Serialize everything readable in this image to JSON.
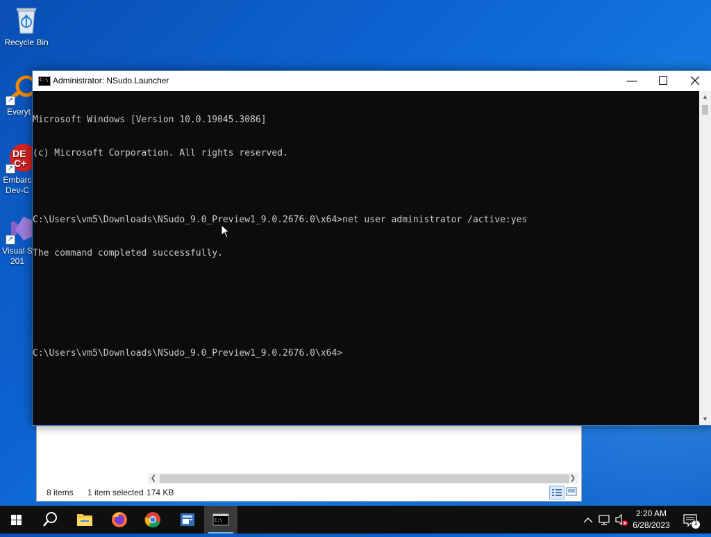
{
  "desktop": {
    "icons": [
      {
        "label": "Recycle Bin"
      },
      {
        "label": "Everyt"
      },
      {
        "label": "Embarc\nDev-C"
      },
      {
        "label": "Visual S\n201"
      }
    ]
  },
  "console": {
    "title": "Administrator: NSudo.Launcher",
    "lines": [
      "Microsoft Windows [Version 10.0.19045.3086]",
      "(c) Microsoft Corporation. All rights reserved.",
      "",
      "C:\\Users\\vm5\\Downloads\\NSudo_9.0_Preview1_9.0.2676.0\\x64>net user administrator /active:yes",
      "The command completed successfully.",
      "",
      "",
      "C:\\Users\\vm5\\Downloads\\NSudo_9.0_Preview1_9.0.2676.0\\x64>"
    ]
  },
  "explorer": {
    "item_count": "8 items",
    "selection": "1 item selected",
    "size": "174 KB"
  },
  "taskbar": {
    "time": "2:20 AM",
    "date": "6/28/2023",
    "notification_count": "1"
  },
  "colors": {
    "console_bg": "#0c0c0c",
    "console_text": "#cccccc",
    "taskbar_bg": "#0f0f0f"
  }
}
